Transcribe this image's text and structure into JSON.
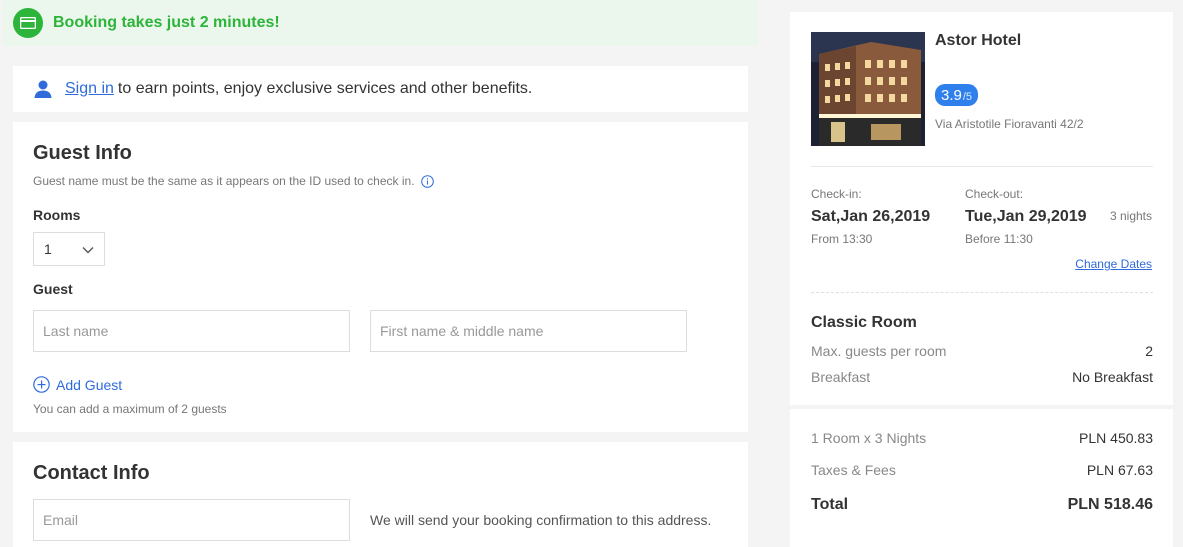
{
  "banner": {
    "text": "Booking takes just 2 minutes!",
    "icon": "card-icon",
    "color": "#2db43a"
  },
  "signin": {
    "link": "Sign in",
    "text": "to earn points, enjoy exclusive services and other benefits."
  },
  "guest_info": {
    "title": "Guest Info",
    "note": "Guest name must be the same as it appears on the ID used to check in.",
    "rooms_label": "Rooms",
    "rooms_value": "1",
    "guest_label": "Guest",
    "last_name_placeholder": "Last name",
    "first_name_placeholder": "First name & middle name",
    "add_guest": "Add Guest",
    "max_note": "You can add a maximum of 2 guests"
  },
  "contact_info": {
    "title": "Contact Info",
    "email_placeholder": "Email",
    "note": "We will send your booking confirmation to this address."
  },
  "hotel": {
    "name": "Astor Hotel",
    "rating": "3.9",
    "rating_den": "/5",
    "address": "Via Aristotile Fioravanti 42/2"
  },
  "stay": {
    "checkin_label": "Check-in:",
    "checkin_date": "Sat,Jan 26,2019",
    "checkin_time": "From 13:30",
    "checkout_label": "Check-out:",
    "checkout_date": "Tue,Jan 29,2019",
    "checkout_time": "Before 11:30",
    "nights": "3 nights",
    "change_dates": "Change Dates"
  },
  "room": {
    "title": "Classic Room",
    "max_guests_label": "Max. guests per room",
    "max_guests_value": "2",
    "breakfast_label": "Breakfast",
    "breakfast_value": "No Breakfast"
  },
  "price": {
    "room_nights_label": "1 Room x 3 Nights",
    "room_nights_value": "PLN 450.83",
    "taxes_label": "Taxes & Fees",
    "taxes_value": "PLN 67.63",
    "total_label": "Total",
    "total_value": "PLN 518.46"
  },
  "colors": {
    "link": "#2f6bdb",
    "rating_bg": "#2f80ed"
  }
}
